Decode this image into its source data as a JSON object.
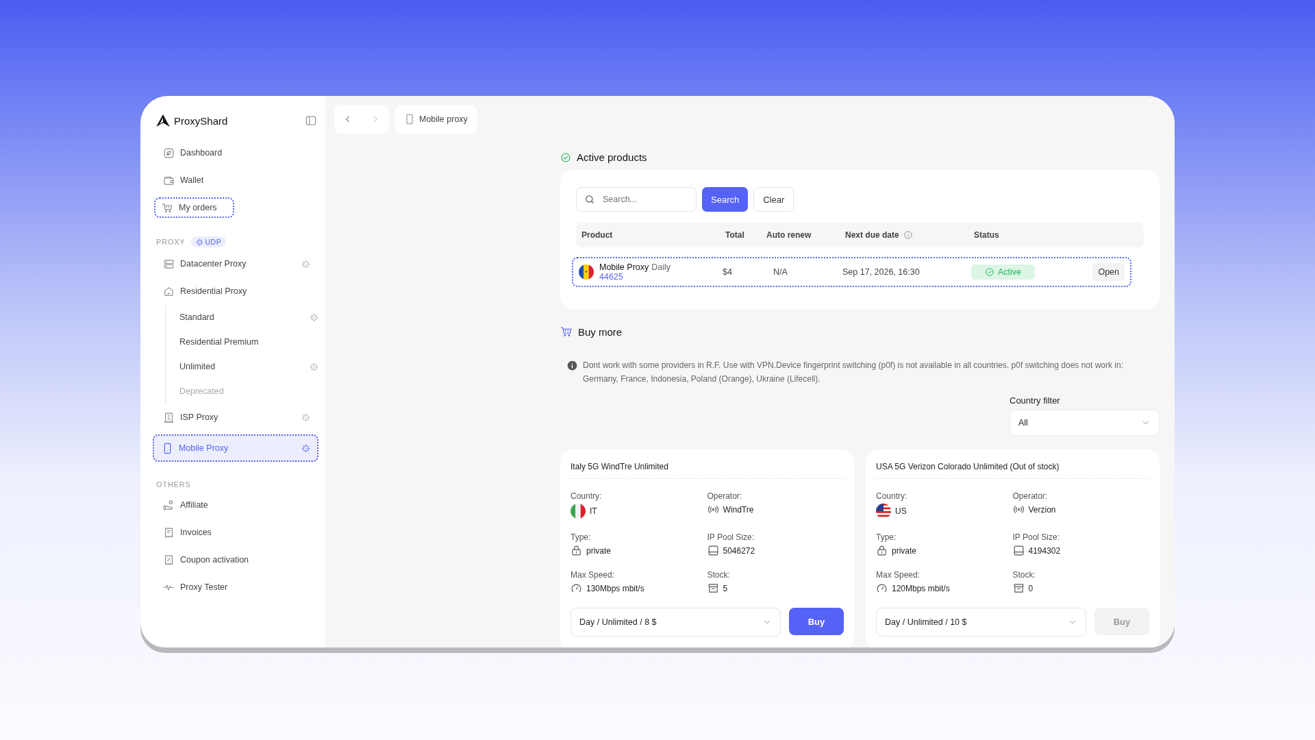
{
  "brand": {
    "name": "ProxyShard"
  },
  "sidebar": {
    "top_items": [
      {
        "label": "Dashboard",
        "selected": false,
        "focused": false
      },
      {
        "label": "Wallet",
        "selected": false,
        "focused": false
      },
      {
        "label": "My orders",
        "selected": false,
        "focused": true
      }
    ],
    "proxy_section": {
      "title": "PROXY",
      "badge": "UDP",
      "items": [
        {
          "label": "Datacenter Proxy",
          "udp": true,
          "selected": false
        },
        {
          "label": "Residential Proxy",
          "udp": false,
          "selected": false,
          "children": [
            {
              "label": "Standard",
              "udp": true,
              "disabled": false
            },
            {
              "label": "Residential Premium",
              "udp": false,
              "disabled": false
            },
            {
              "label": "Unlimited",
              "udp": true,
              "disabled": false
            },
            {
              "label": "Deprecated",
              "udp": false,
              "disabled": true
            }
          ]
        },
        {
          "label": "ISP Proxy",
          "udp": true,
          "selected": false
        },
        {
          "label": "Mobile Proxy",
          "udp": true,
          "selected": true
        }
      ]
    },
    "others_section": {
      "title": "OTHERS",
      "items": [
        {
          "label": "Affiliate"
        },
        {
          "label": "Invoices"
        },
        {
          "label": "Coupon activation"
        },
        {
          "label": "Proxy Tester"
        }
      ]
    }
  },
  "breadcrumb": {
    "label": "Mobile proxy"
  },
  "active_products": {
    "title": "Active products",
    "search": {
      "placeholder": "Search...",
      "search_button": "Search",
      "clear_button": "Clear"
    },
    "columns": [
      {
        "label": "Product",
        "info": false
      },
      {
        "label": "Total",
        "info": false
      },
      {
        "label": "Auto renew",
        "info": false
      },
      {
        "label": "Next due date",
        "info": true
      },
      {
        "label": "Status",
        "info": false
      }
    ],
    "rows": [
      {
        "product": "Mobile Proxy",
        "plan": "Daily",
        "id": "44625",
        "total": "$4",
        "auto_renew": "N/A",
        "next_due": "Sep 17, 2026, 16:30",
        "status": {
          "label": "Active",
          "kind": "active"
        },
        "action": "Open",
        "focused": true
      }
    ]
  },
  "buy_more": {
    "title": "Buy more",
    "notice": "Dont work with some providers in R.F. Use with VPN.Device fingerprint switching (p0f) is not available in all countries. p0f switching does not work in: Germany, France, Indonesia, Poland (Orange), Ukraine (Lifecell).",
    "country_filter": {
      "label": "Country filter",
      "value": "All"
    },
    "offers": [
      {
        "title": "Italy 5G WindTre Unlimited",
        "fields": [
          {
            "label": "Country:",
            "value": "IT",
            "kind": "flag"
          },
          {
            "label": "Operator:",
            "value": "WindTre",
            "kind": "signal"
          },
          {
            "label": "Type:",
            "value": "private",
            "kind": "lock"
          },
          {
            "label": "IP Pool Size:",
            "value": "5046272",
            "kind": "pool"
          },
          {
            "label": "Max Speed:",
            "value": "130Mbps mbit/s",
            "kind": "speed"
          },
          {
            "label": "Stock:",
            "value": "5",
            "kind": "stock"
          }
        ],
        "plan": "Day / Unlimited / 8 $",
        "buy": "Buy",
        "disabled": false
      },
      {
        "title": "USA 5G Verizon Colorado Unlimited (Out of stock)",
        "fields": [
          {
            "label": "Country:",
            "value": "US",
            "kind": "flag"
          },
          {
            "label": "Operator:",
            "value": "Verzion",
            "kind": "signal"
          },
          {
            "label": "Type:",
            "value": "private",
            "kind": "lock"
          },
          {
            "label": "IP Pool Size:",
            "value": "4194302",
            "kind": "pool"
          },
          {
            "label": "Max Speed:",
            "value": "120Mbps mbit/s",
            "kind": "speed"
          },
          {
            "label": "Stock:",
            "value": "0",
            "kind": "stock"
          }
        ],
        "plan": "Day / Unlimited / 10 $",
        "buy": "Buy",
        "disabled": true
      }
    ]
  }
}
